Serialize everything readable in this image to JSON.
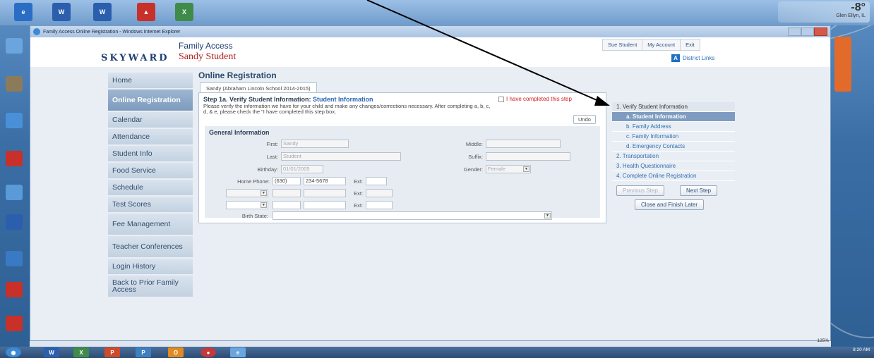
{
  "window": {
    "title": "Family Access Online Registration - Windows Internet Explorer"
  },
  "weather": {
    "temp": "-8°",
    "city": "Glen Ellyn, IL"
  },
  "header": {
    "logo": "SKYWARD",
    "app_title": "Family Access",
    "student_name": "Sandy Student",
    "links": [
      "Sue Student",
      "My Account",
      "Exit"
    ],
    "district_links": "District Links"
  },
  "nav": {
    "items": [
      {
        "label": "Home"
      },
      {
        "label": "Online Registration"
      },
      {
        "label": "Calendar"
      },
      {
        "label": "Attendance"
      },
      {
        "label": "Student Info"
      },
      {
        "label": "Food Service"
      },
      {
        "label": "Schedule"
      },
      {
        "label": "Test Scores"
      },
      {
        "label": "Fee Management"
      },
      {
        "label": "Teacher Conferences"
      },
      {
        "label": "Login History"
      },
      {
        "label": "Back to Prior Family Access"
      }
    ]
  },
  "main": {
    "title": "Online Registration",
    "tab": "Sandy (Abraham Lincoln School 2014-2015)",
    "step_title": "Step 1a. Verify Student Information:",
    "step_subtitle": "Student Information",
    "step_desc": "Please verify the information we have for your child and make any changes/corrections necessary. After completing a, b, c, d, & e, please check the \"I have completed this step box.",
    "completed_label": "I have completed this step",
    "undo_label": "Undo",
    "general_info": "General Information",
    "fields": {
      "first_label": "First:",
      "first_value": "Sandy",
      "middle_label": "Middle:",
      "last_label": "Last:",
      "last_value": "Student",
      "suffix_label": "Suffix:",
      "birthday_label": "Birthday:",
      "birthday_value": "01/01/2005",
      "gender_label": "Gender:",
      "gender_value": "Female",
      "home_phone_label": "Home Phone:",
      "area_code": "(630)",
      "phone_number": "234-5678",
      "ext_label": "Ext:",
      "birth_state_label": "Birth State:"
    }
  },
  "steps": {
    "items": [
      {
        "label": "1. Verify Student Information"
      },
      {
        "label": "a. Student Information"
      },
      {
        "label": "b. Family Address"
      },
      {
        "label": "c. Family Information"
      },
      {
        "label": "d. Emergency Contacts"
      },
      {
        "label": "2. Transportation"
      },
      {
        "label": "3. Health Questionnaire"
      },
      {
        "label": "4. Complete Online Registration"
      }
    ],
    "prev_label": "Previous Step",
    "next_label": "Next Step",
    "close_label": "Close and Finish Later"
  },
  "status": {
    "zoom": "125%"
  },
  "clock": {
    "time": "8:20 AM"
  }
}
